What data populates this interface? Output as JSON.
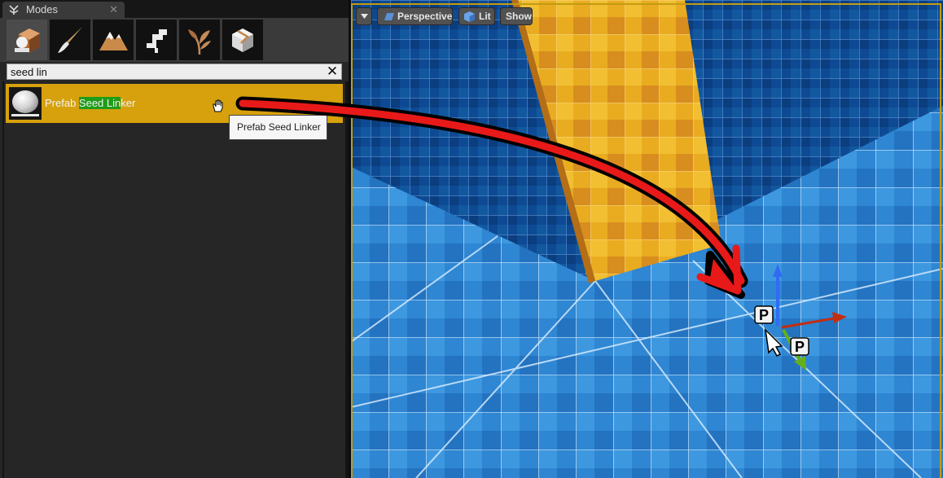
{
  "modes_panel": {
    "tab_title": "Modes",
    "tab_close": "✕",
    "mode_buttons": [
      {
        "name": "place",
        "icon": "place-mode-icon"
      },
      {
        "name": "paint",
        "icon": "paint-brush-icon"
      },
      {
        "name": "landscape",
        "icon": "landscape-mountain-icon"
      },
      {
        "name": "foliage",
        "icon": "foliage-leaf-icon"
      },
      {
        "name": "geometry",
        "icon": "geometry-edit-icon"
      },
      {
        "name": "fracture",
        "icon": "fracture-cube-icon"
      }
    ],
    "search": {
      "value": "seed lin",
      "clear_icon": "✕"
    },
    "result": {
      "label_prefix": "Prefab ",
      "label_highlight": "Seed Lin",
      "label_suffix": "ker",
      "thumbnail_icon": "sphere-actor-icon"
    },
    "tooltip": "Prefab Seed Linker"
  },
  "viewport": {
    "dropdown_icon": "viewport-menu-arrow-icon",
    "perspective_label": "Perspective",
    "lit_label": "Lit",
    "show_label": "Show",
    "scene_labels": {
      "prefab_marker_1": "P",
      "prefab_marker_2": "P"
    }
  },
  "colors": {
    "selection": "#d6a10c",
    "search_highlight": "#1f9c18",
    "viewport_border": "#c39b12",
    "arrow": "#e81919"
  }
}
